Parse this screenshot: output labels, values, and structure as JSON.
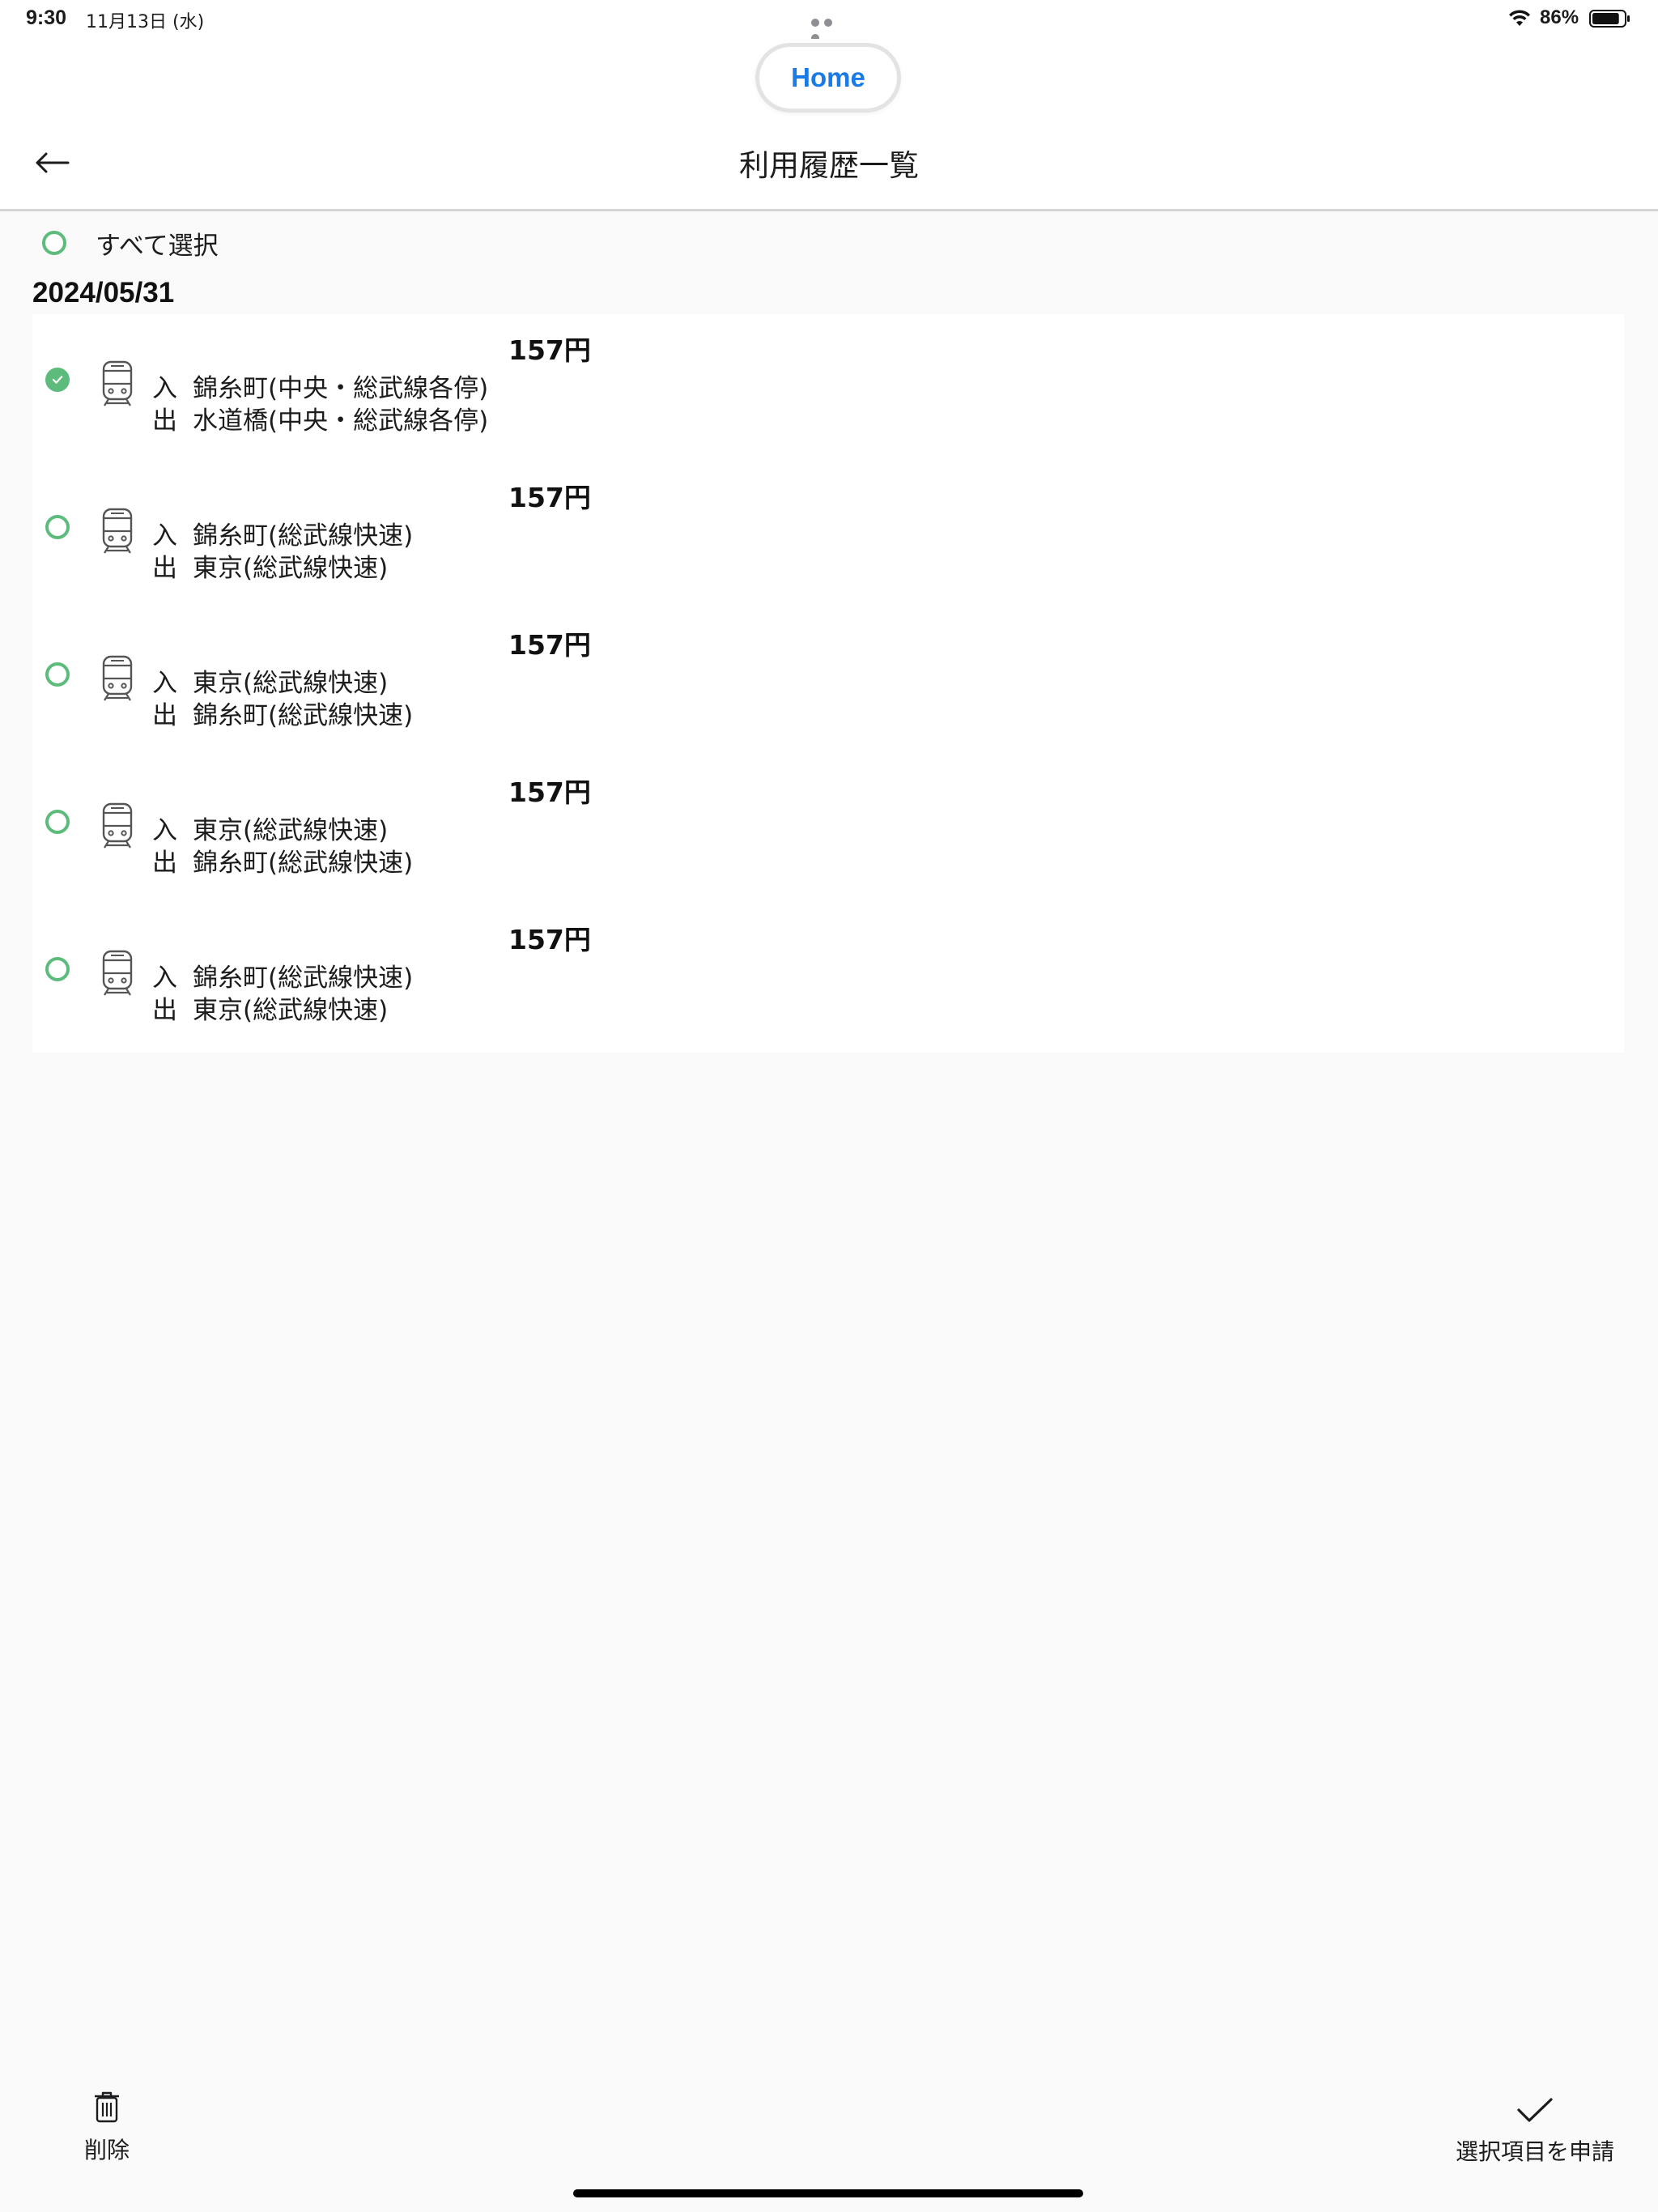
{
  "status_bar": {
    "time": "9:30",
    "date": "11月13日 (水)",
    "battery_percent": "86%",
    "battery_level": 0.86,
    "icons": [
      "multitasking-dots-icon",
      "wifi-icon",
      "battery-icon"
    ]
  },
  "nav": {
    "home_label": "Home",
    "title": "利用履歴一覧",
    "back_icon": "arrow-left-icon"
  },
  "select_all": {
    "label": "すべて選択",
    "checked": false
  },
  "date_group": "2024/05/31",
  "entry_tag": "入",
  "exit_tag": "出",
  "history": [
    {
      "fare": "157円",
      "entry": "錦糸町(中央・総武線各停)",
      "exit": "水道橋(中央・総武線各停)",
      "checked": true,
      "icon": "train-icon"
    },
    {
      "fare": "157円",
      "entry": "錦糸町(総武線快速)",
      "exit": "東京(総武線快速)",
      "checked": false,
      "icon": "train-icon"
    },
    {
      "fare": "157円",
      "entry": "東京(総武線快速)",
      "exit": "錦糸町(総武線快速)",
      "checked": false,
      "icon": "train-icon"
    },
    {
      "fare": "157円",
      "entry": "東京(総武線快速)",
      "exit": "錦糸町(総武線快速)",
      "checked": false,
      "icon": "train-icon"
    },
    {
      "fare": "157円",
      "entry": "錦糸町(総武線快速)",
      "exit": "東京(総武線快速)",
      "checked": false,
      "icon": "train-icon"
    }
  ],
  "toolbar": {
    "delete_label": "削除",
    "apply_label": "選択項目を申請",
    "delete_icon": "trash-icon",
    "apply_icon": "checkmark-icon"
  },
  "colors": {
    "accent_green": "#5dbb7c",
    "home_blue": "#1a7ae6",
    "background": "#fafafa"
  }
}
